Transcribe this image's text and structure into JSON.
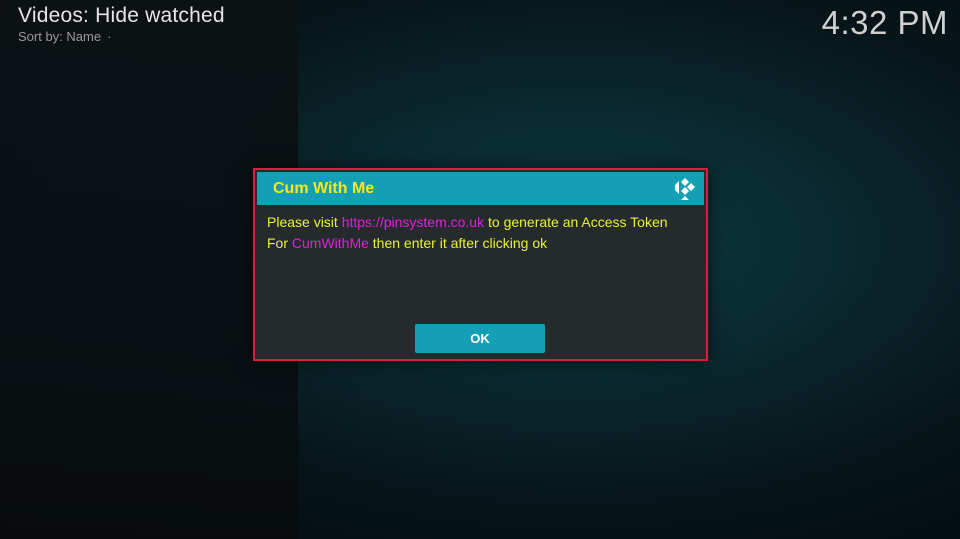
{
  "header": {
    "title": "Videos: Hide watched",
    "sort_label": "Sort by: Name",
    "sort_separator": "·",
    "clock": "4:32 PM"
  },
  "dialog": {
    "title": "Cum With Me",
    "logo_icon": "kodi-logo-icon",
    "message": {
      "line1_prefix": "Please visit ",
      "line1_link": "https://pinsystem.co.uk",
      "line1_suffix": " to generate an Access Token",
      "line2_prefix": "For ",
      "line2_link": "CumWithMe",
      "line2_suffix": " then enter it after clicking ok"
    },
    "ok_label": "OK"
  },
  "colors": {
    "accent": "#14a0b4",
    "title_text": "#ffe51a",
    "body_text": "#e8f234",
    "link_text": "#e020d8",
    "highlight_border": "#d8203a"
  }
}
